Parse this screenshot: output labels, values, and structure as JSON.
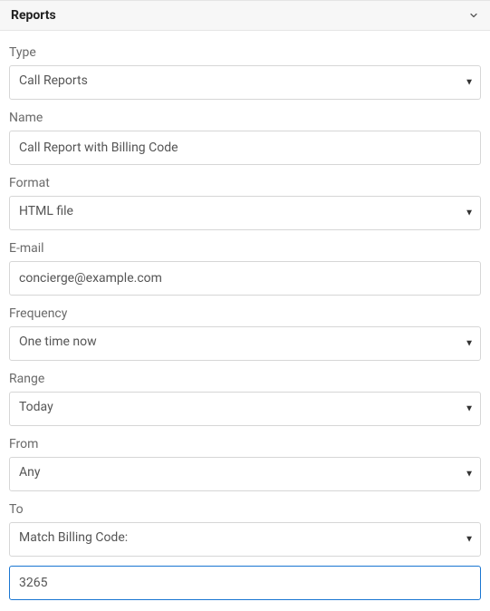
{
  "panel": {
    "title": "Reports"
  },
  "form": {
    "type": {
      "label": "Type",
      "value": "Call Reports"
    },
    "name": {
      "label": "Name",
      "value": "Call Report with Billing Code"
    },
    "format": {
      "label": "Format",
      "value": "HTML file"
    },
    "email": {
      "label": "E-mail",
      "value": "concierge@example.com"
    },
    "frequency": {
      "label": "Frequency",
      "value": "One time now"
    },
    "range": {
      "label": "Range",
      "value": "Today"
    },
    "from": {
      "label": "From",
      "value": "Any"
    },
    "to": {
      "label": "To",
      "value": "Match Billing Code:"
    },
    "code": {
      "value": "3265"
    }
  }
}
